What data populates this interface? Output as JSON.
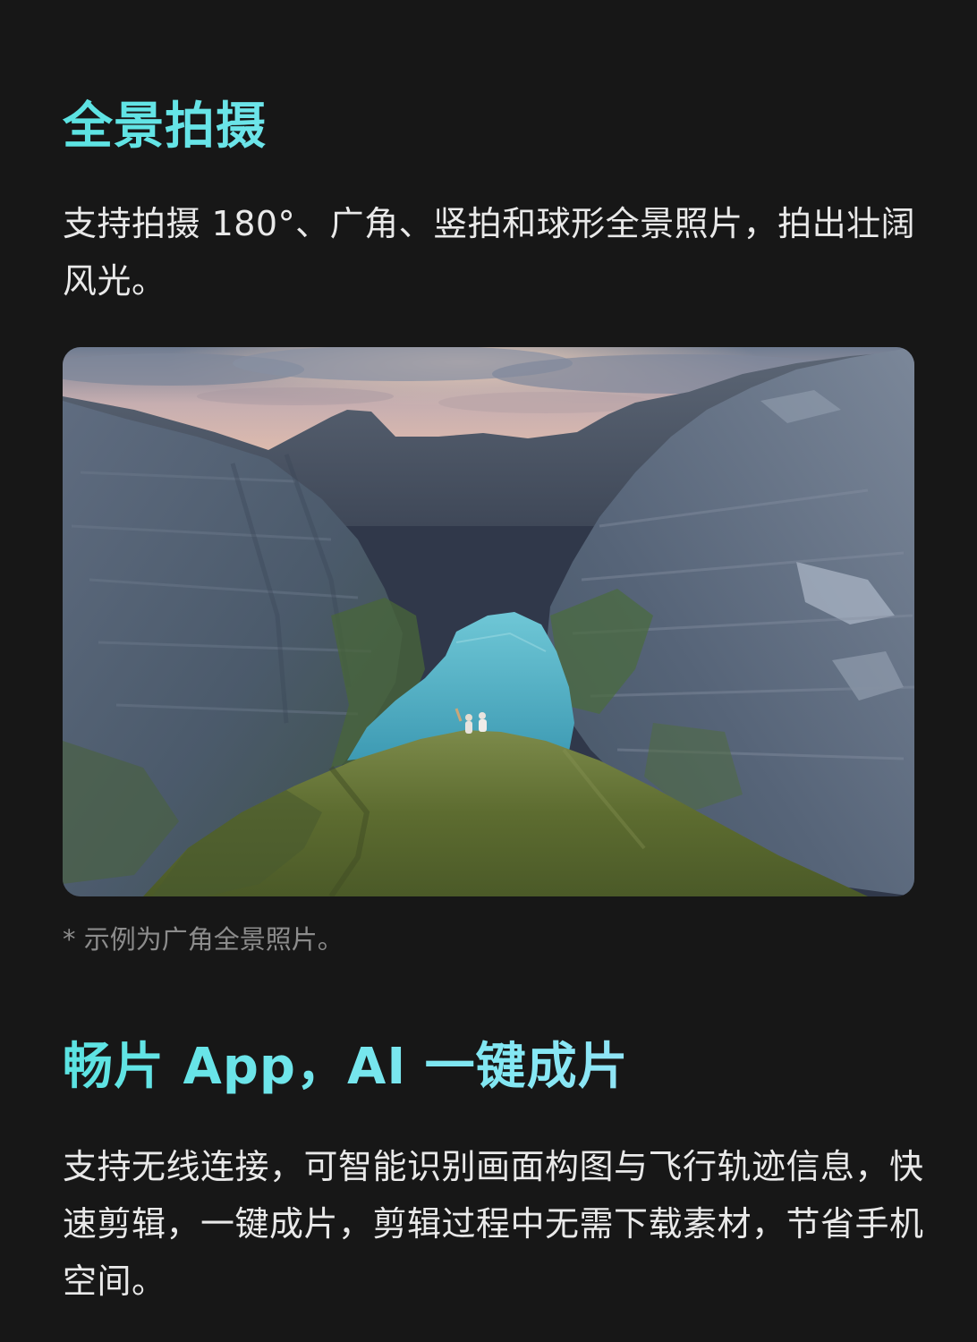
{
  "panorama": {
    "title": "全景拍摄",
    "description": "支持拍摄 180°、广角、竖拍和球形全景照片，拍出壮阔风光。",
    "image_caption": "* 示例为广角全景照片。"
  },
  "app_section": {
    "title": "畅片 App，AI 一键成片",
    "description": "支持无线连接，可智能识别画面构图与飞行轨迹信息，快速剪辑，一键成片，剪辑过程中无需下载素材，节省手机空间。"
  },
  "colors": {
    "background": "#171717",
    "title_gradient_start": "#5be3e2",
    "title_gradient_end": "#b6dcff",
    "body_text": "#e9e9e9",
    "caption_text": "#8c8c8c"
  }
}
